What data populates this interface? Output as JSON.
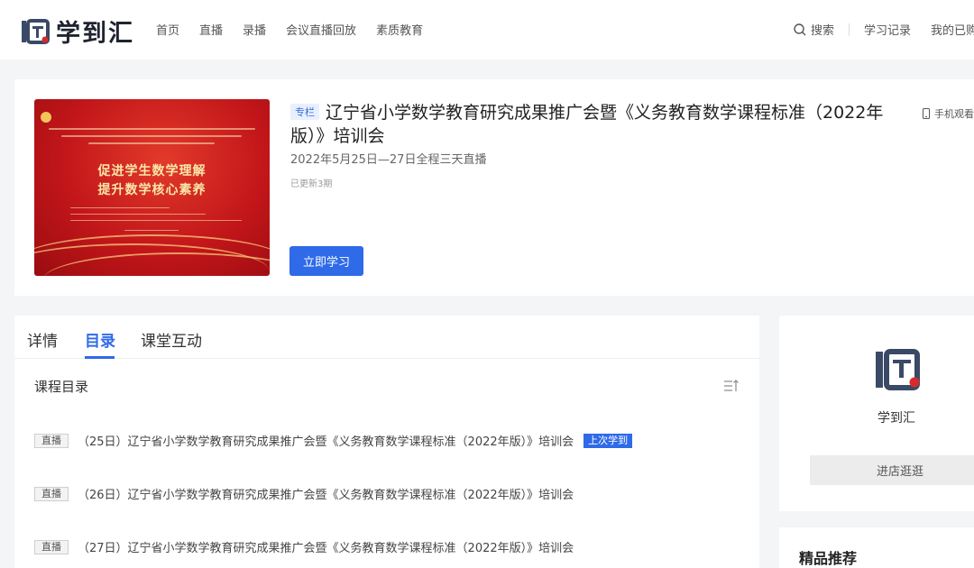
{
  "header": {
    "brand": "学到汇",
    "nav": [
      "首页",
      "直播",
      "录播",
      "会议直播回放",
      "素质教育"
    ],
    "search_label": "搜索",
    "study_record": "学习记录",
    "my_purchased": "我的已购"
  },
  "course": {
    "tag": "专栏",
    "title": "辽宁省小学数学教育研究成果推广会暨《义务教育数学课程标准（2022年版）》培训会",
    "date": "2022年5月25日—27日全程三天直播",
    "updated": "已更新3期",
    "study_button": "立即学习",
    "mobile_watch": "手机观看",
    "cover": {
      "headline_1": "促进学生数学理解",
      "headline_2": "提升数学核心素养"
    }
  },
  "tabs": [
    {
      "label": "详情",
      "active": false
    },
    {
      "label": "目录",
      "active": true
    },
    {
      "label": "课堂互动",
      "active": false
    }
  ],
  "catalog": {
    "title": "课程目录",
    "lessons": [
      {
        "tag": "直播",
        "title": "（25日）辽宁省小学数学教育研究成果推广会暨《义务教育数学课程标准（2022年版）》培训会",
        "badge": "上次学到"
      },
      {
        "tag": "直播",
        "title": "（26日）辽宁省小学数学教育研究成果推广会暨《义务教育数学课程标准（2022年版）》培训会"
      },
      {
        "tag": "直播",
        "title": "（27日）辽宁省小学数学教育研究成果推广会暨《义务教育数学课程标准（2022年版）》培训会"
      }
    ]
  },
  "store": {
    "name": "学到汇",
    "enter_button": "进店逛逛"
  },
  "recommend": {
    "title": "精品推荐"
  },
  "colors": {
    "accent": "#2f6ae8",
    "cover_red": "#c2161a",
    "cover_gold": "#f9e7a8"
  }
}
